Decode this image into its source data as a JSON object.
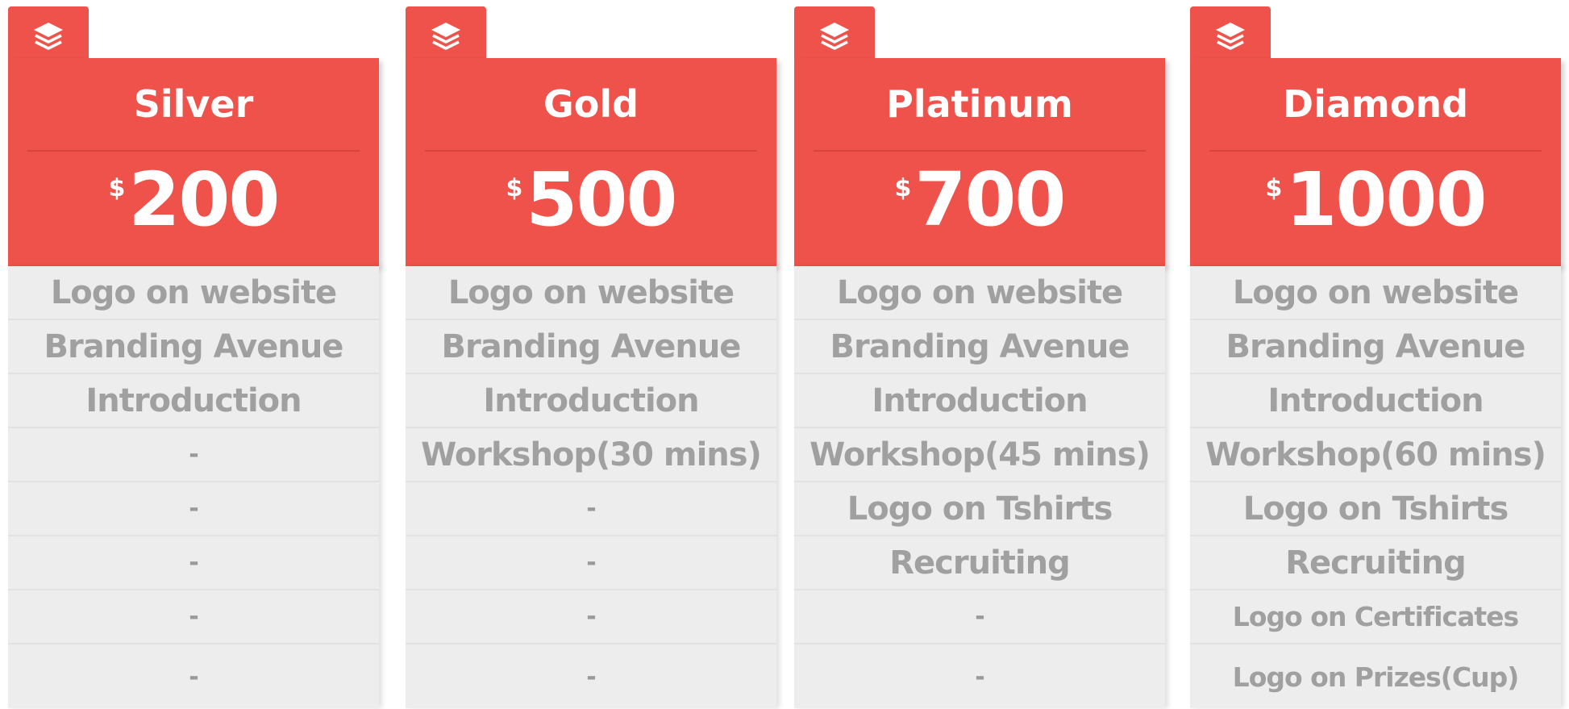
{
  "plans": [
    {
      "name": "Silver",
      "currency": "$",
      "price": "200",
      "features": [
        "Logo on website",
        "Branding Avenue",
        "Introduction",
        "-",
        "-",
        "-",
        "-",
        "-"
      ]
    },
    {
      "name": "Gold",
      "currency": "$",
      "price": "500",
      "features": [
        "Logo on website",
        "Branding Avenue",
        "Introduction",
        "Workshop(30 mins)",
        "-",
        "-",
        "-",
        "-"
      ]
    },
    {
      "name": "Platinum",
      "currency": "$",
      "price": "700",
      "features": [
        "Logo on website",
        "Branding Avenue",
        "Introduction",
        "Workshop(45 mins)",
        "Logo on Tshirts",
        "Recruiting",
        "-",
        "-"
      ]
    },
    {
      "name": "Diamond",
      "currency": "$",
      "price": "1000",
      "features": [
        "Logo on website",
        "Branding Avenue",
        "Introduction",
        "Workshop(60 mins)",
        "Logo on Tshirts",
        "Recruiting",
        "Logo on Certificates",
        "Logo on Prizes(Cup)"
      ]
    }
  ],
  "icons": {
    "tab": "layers-icon"
  },
  "colors": {
    "accent": "#ee524b",
    "feature_bg": "#ededed",
    "feature_text": "#a0a0a0"
  }
}
